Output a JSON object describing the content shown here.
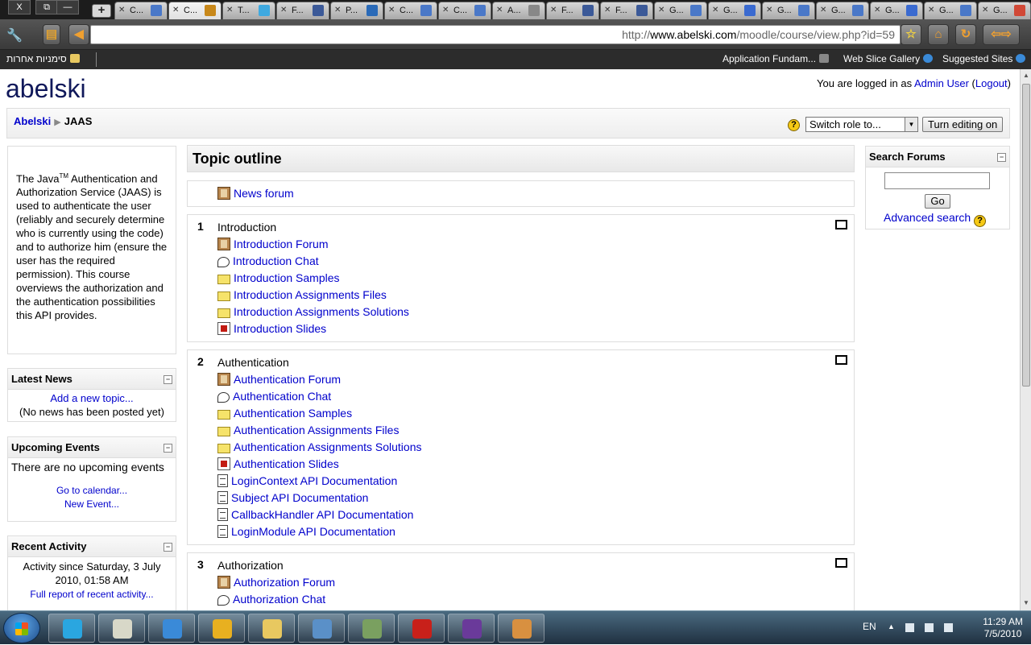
{
  "browser": {
    "window_controls": {
      "close": "X",
      "restore": "⧉",
      "minimize": "—"
    },
    "tabs": [
      {
        "label": "C...",
        "icon": "document-icon",
        "color": "#4a78c8"
      },
      {
        "label": "C...",
        "icon": "linkedin-icon",
        "color": "#c8881a",
        "active": true
      },
      {
        "label": "T...",
        "icon": "twitter-icon",
        "color": "#3fa9e0"
      },
      {
        "label": "F...",
        "icon": "facebook-icon",
        "color": "#3b5998"
      },
      {
        "label": "P...",
        "icon": "bird-icon",
        "color": "#2a6ab8"
      },
      {
        "label": "C...",
        "icon": "document-icon",
        "color": "#4a78c8"
      },
      {
        "label": "C...",
        "icon": "document-icon",
        "color": "#4a78c8"
      },
      {
        "label": "A...",
        "icon": "page-icon",
        "color": "#888888"
      },
      {
        "label": "F...",
        "icon": "facebook-icon",
        "color": "#3b5998"
      },
      {
        "label": "F...",
        "icon": "facebook-icon",
        "color": "#3b5998"
      },
      {
        "label": "G...",
        "icon": "document-icon",
        "color": "#4a78c8"
      },
      {
        "label": "G...",
        "icon": "calendar-icon",
        "color": "#3a6ad0"
      },
      {
        "label": "G...",
        "icon": "document-icon",
        "color": "#4a78c8"
      },
      {
        "label": "G...",
        "icon": "document-icon",
        "color": "#4a78c8"
      },
      {
        "label": "G...",
        "icon": "calendar-icon",
        "color": "#3a6ad0"
      },
      {
        "label": "G...",
        "icon": "document-icon",
        "color": "#4a78c8"
      },
      {
        "label": "G...",
        "icon": "gmail-icon",
        "color": "#d14836"
      }
    ],
    "new_tab": "+",
    "url_prefix": "http://",
    "url_domain": "www.abelski.com",
    "url_path": "/moodle/course/view.php?id=59",
    "bookmarks": {
      "other_bookmarks": "סימניות אחרות",
      "items": [
        "Application Fundam...",
        "Web Slice Gallery",
        "Suggested Sites"
      ]
    }
  },
  "moodle": {
    "site_name": "abelski",
    "login_prefix": "You are logged in as",
    "login_user": "Admin User",
    "logout": "Logout",
    "breadcrumb": {
      "home": "Abelski",
      "separator": "▶",
      "current": "JAAS"
    },
    "switch_role": "Switch role to...",
    "turn_editing": "Turn editing on",
    "summary": {
      "part1": "The Java",
      "tm": "TM",
      "part2": " Authentication and Authorization Service (JAAS) is used to authenticate the user (reliably and securely determine who is currently using the code) and to authorize him (ensure the user has the required permission). This course overviews the authorization and the authentication possibilities this API provides."
    },
    "latest_news": {
      "title": "Latest News",
      "add_topic": "Add a new topic...",
      "empty": "(No news has been posted yet)"
    },
    "upcoming_events": {
      "title": "Upcoming Events",
      "empty": "There are no upcoming events",
      "calendar": "Go to calendar...",
      "new_event": "New Event..."
    },
    "recent_activity": {
      "title": "Recent Activity",
      "since": "Activity since Saturday, 3 July 2010, 01:58 AM",
      "full_report": "Full report of recent activity..."
    },
    "search_forums": {
      "title": "Search Forums",
      "go": "Go",
      "advanced": "Advanced search"
    },
    "topic_outline": "Topic outline",
    "news_forum": "News forum",
    "sections": [
      {
        "number": "1",
        "title": "Introduction",
        "activities": [
          {
            "type": "forum",
            "label": "Introduction Forum"
          },
          {
            "type": "chat",
            "label": "Introduction Chat"
          },
          {
            "type": "folder",
            "label": "Introduction Samples"
          },
          {
            "type": "folder",
            "label": "Introduction Assignments Files"
          },
          {
            "type": "folder",
            "label": "Introduction Assignments Solutions"
          },
          {
            "type": "pdf",
            "label": "Introduction Slides"
          }
        ]
      },
      {
        "number": "2",
        "title": "Authentication",
        "activities": [
          {
            "type": "forum",
            "label": "Authentication Forum"
          },
          {
            "type": "chat",
            "label": "Authentication Chat"
          },
          {
            "type": "folder",
            "label": "Authentication Samples"
          },
          {
            "type": "folder",
            "label": "Authentication Assignments Files"
          },
          {
            "type": "folder",
            "label": "Authentication Assignments Solutions"
          },
          {
            "type": "pdf",
            "label": "Authentication Slides"
          },
          {
            "type": "doc",
            "label": "LoginContext API Documentation"
          },
          {
            "type": "doc",
            "label": "Subject API Documentation"
          },
          {
            "type": "doc",
            "label": "CallbackHandler API Documentation"
          },
          {
            "type": "doc",
            "label": "LoginModule API Documentation"
          }
        ]
      },
      {
        "number": "3",
        "title": "Authorization",
        "activities": [
          {
            "type": "forum",
            "label": "Authorization Forum"
          },
          {
            "type": "chat",
            "label": "Authorization Chat"
          }
        ]
      }
    ]
  },
  "taskbar": {
    "apps": [
      {
        "name": "skype",
        "color": "#2aa6e0"
      },
      {
        "name": "notepad",
        "color": "#d8d8c8"
      },
      {
        "name": "internet-explorer",
        "color": "#3a8ad8"
      },
      {
        "name": "chrome",
        "color": "#e8b020"
      },
      {
        "name": "explorer",
        "color": "#e8c860"
      },
      {
        "name": "remote-desktop",
        "color": "#5a90c8"
      },
      {
        "name": "calculator",
        "color": "#7aa060"
      },
      {
        "name": "acrobat",
        "color": "#c8201a"
      },
      {
        "name": "app-star",
        "color": "#6a3a9a"
      },
      {
        "name": "paint",
        "color": "#d89040"
      }
    ],
    "language": "EN",
    "time": "11:29 AM",
    "date": "7/5/2010"
  }
}
